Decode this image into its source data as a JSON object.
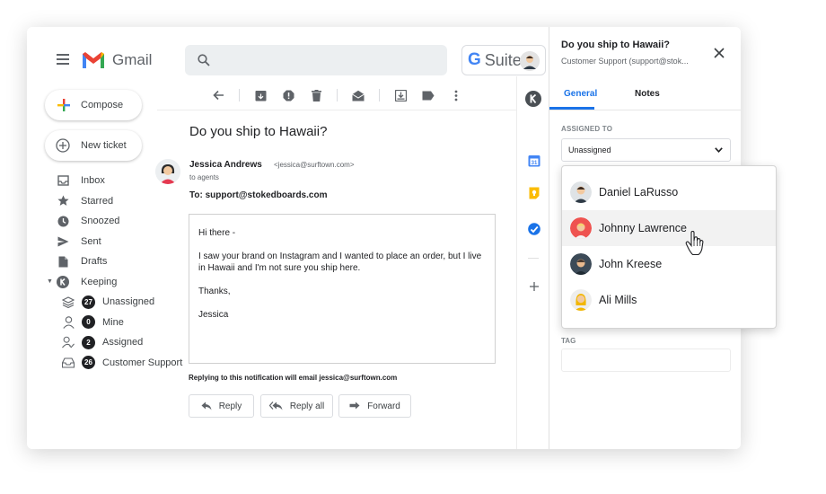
{
  "app": {
    "name": "Gmail",
    "gsuite_g": "G",
    "gsuite_label": "Suite"
  },
  "sidebar": {
    "compose_label": "Compose",
    "new_ticket_label": "New ticket",
    "items": [
      {
        "label": "Inbox",
        "icon": "inbox-icon"
      },
      {
        "label": "Starred",
        "icon": "star-icon"
      },
      {
        "label": "Snoozed",
        "icon": "clock-icon"
      },
      {
        "label": "Sent",
        "icon": "send-icon"
      },
      {
        "label": "Drafts",
        "icon": "draft-icon"
      },
      {
        "label": "Keeping",
        "icon": "keeping-logo-icon"
      }
    ],
    "sub_items": [
      {
        "label": "Unassigned",
        "count": "27",
        "icon": "layers-icon"
      },
      {
        "label": "Mine",
        "count": "0",
        "icon": "person-icon"
      },
      {
        "label": "Assigned",
        "count": "2",
        "icon": "person-check-icon"
      },
      {
        "label": "Customer Support",
        "count": "26",
        "icon": "tray-icon"
      }
    ]
  },
  "email": {
    "subject": "Do you ship to Hawaii?",
    "sender_name": "Jessica Andrews",
    "sender_email": "<jessica@surftown.com>",
    "to_agents": "to agents",
    "to_line": "To: support@stokedboards.com",
    "body": {
      "greeting": "Hi there -",
      "paragraph": "I saw your brand on Instagram and I wanted to place an order, but I live in Hawaii and I'm not sure you ship here.",
      "closing": "Thanks,",
      "signature": "Jessica"
    },
    "reply_note": "Replying to this notification will email jessica@surftown.com",
    "buttons": {
      "reply": "Reply",
      "reply_all": "Reply all",
      "forward": "Forward"
    }
  },
  "panel": {
    "title": "Do you ship to Hawaii?",
    "subtitle": "Customer Support (support@stok...",
    "tabs": {
      "general": "General",
      "notes": "Notes"
    },
    "assigned_to_label": "ASSIGNED TO",
    "assigned_value": "Unassigned",
    "tag_label": "TAG"
  },
  "dropdown": {
    "options": [
      {
        "name": "Daniel LaRusso"
      },
      {
        "name": "Johnny Lawrence"
      },
      {
        "name": "John Kreese"
      },
      {
        "name": "Ali Mills"
      }
    ]
  },
  "colors": {
    "accent": "#1a73e8",
    "gmail_red": "#ea4335"
  }
}
